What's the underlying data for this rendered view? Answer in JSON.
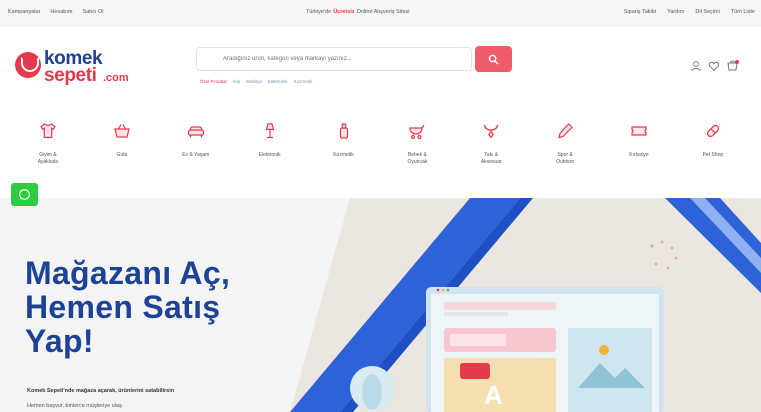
{
  "topbar": {
    "left_links": [
      "Kampanyalar",
      "Hesabım",
      "Satıcı Ol"
    ],
    "center_text": [
      "Türkiye'de",
      "Ücretsiz",
      "Online Alışveriş Sitesi"
    ],
    "right_links": [
      "Sipariş Takibi",
      "Yardım",
      "Dil Seçimi",
      "Tüm Liste"
    ]
  },
  "header": {
    "logo": {
      "word1": "komek",
      "word2": "sepeti",
      "tld": ".com"
    },
    "search": {
      "placeholder": "Aradığınız ürün, kategori veya markayı yazınız..."
    },
    "quick_tags": [
      "Özel Fırsatlar",
      "Kişi",
      "Mobilya",
      "Elektronik",
      "Kozmetik"
    ],
    "icons": [
      "user-icon",
      "heart-icon",
      "cart-icon"
    ]
  },
  "categories": [
    {
      "label": "Giyim &\nAyakkabı",
      "icon": "tshirt-icon"
    },
    {
      "label": "Gıda",
      "icon": "shopping-basket-icon"
    },
    {
      "label": "Ev & Yaşam",
      "icon": "sofa-icon"
    },
    {
      "label": "Elektronik",
      "icon": "lamp-icon"
    },
    {
      "label": "Kozmetik",
      "icon": "perfume-icon"
    },
    {
      "label": "Bebek &\nOyuncak",
      "icon": "stroller-icon"
    },
    {
      "label": "Takı &\nAksesuar",
      "icon": "necklace-icon"
    },
    {
      "label": "Spor &\nOutdoor",
      "icon": "pen-icon"
    },
    {
      "label": "Kırtasiye",
      "icon": "ticket-icon"
    },
    {
      "label": "Pet Shop",
      "icon": "pill-icon"
    }
  ],
  "hero": {
    "title_lines": [
      "Mağazanı Aç,",
      "Hemen Satış",
      "Yap!"
    ],
    "line1": "Komek Sepeti'nde mağaza açarak, ürünlerini satabilirsin",
    "line2": "Hemen başvur, binlerce müşteriye ulaş."
  },
  "colors": {
    "brand_blue": "#1d4396",
    "brand_red": "#e6394b",
    "search_button": "#f05b6a",
    "whatsapp_green": "#2ecc40"
  }
}
